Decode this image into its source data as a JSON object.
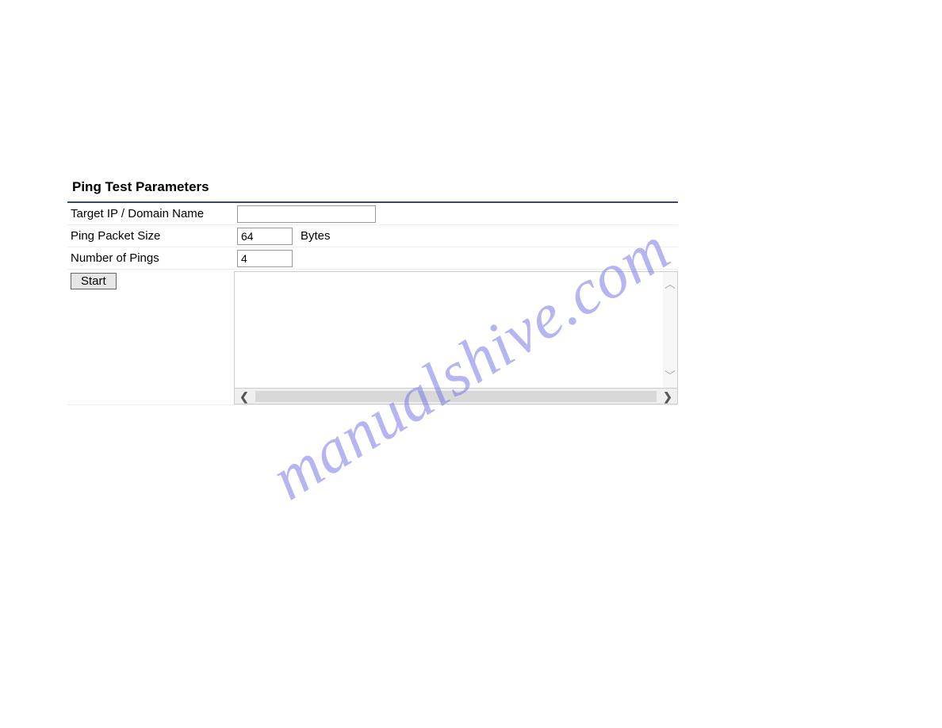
{
  "section_title": "Ping Test Parameters",
  "form": {
    "target_label": "Target IP / Domain Name",
    "target_value": "",
    "packet_size_label": "Ping Packet Size",
    "packet_size_value": "64",
    "packet_size_unit": "Bytes",
    "num_pings_label": "Number of Pings",
    "num_pings_value": "4"
  },
  "start_button_label": "Start",
  "output_content": "",
  "watermark_text": "manualshive.com"
}
